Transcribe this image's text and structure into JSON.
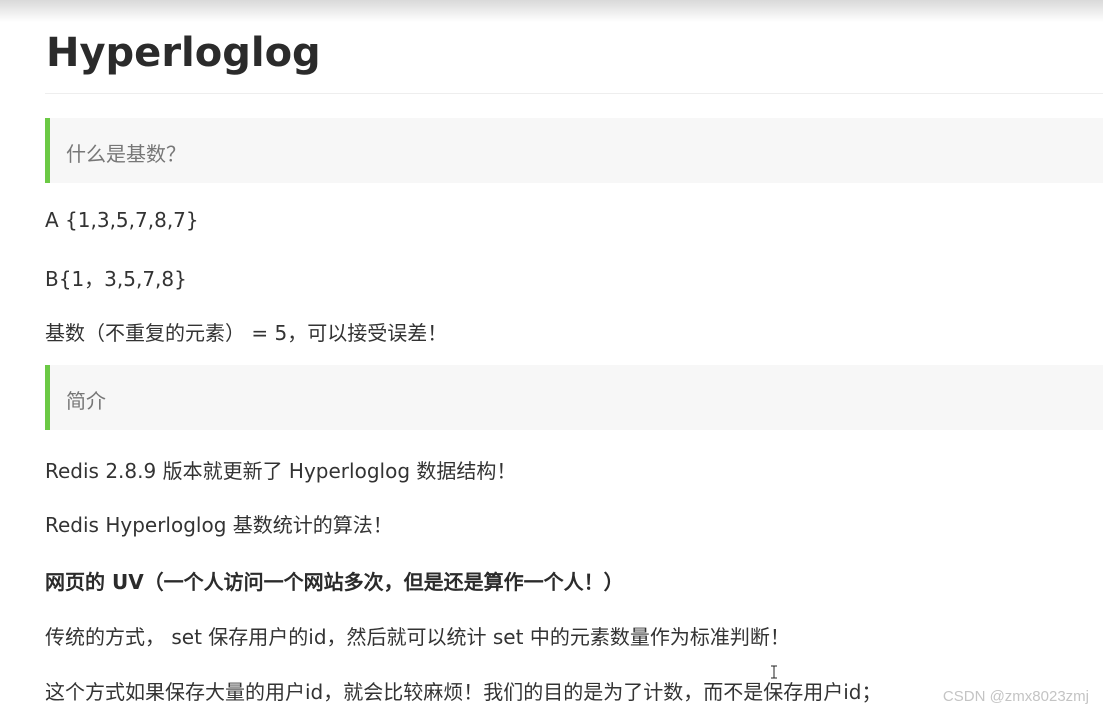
{
  "doc": {
    "title": "Hyperloglog",
    "quote1": "什么是基数？",
    "lines1": [
      "A {1,3,5,7,8,7}",
      "B{1，3,5,7,8}",
      "基数（不重复的元素） = 5，可以接受误差！"
    ],
    "quote2": "简介",
    "lines2": [
      "Redis 2.8.9 版本就更新了 Hyperloglog 数据结构！",
      "Redis Hyperloglog  基数统计的算法！",
      "网页的 UV（一个人访问一个网站多次，但是还是算作一个人！）",
      "传统的方式， set 保存用户的id，然后就可以统计 set 中的元素数量作为标准判断！",
      "这个方式如果保存大量的用户id，就会比较麻烦！我们的目的是为了计数，而不是保存用户id；"
    ]
  },
  "watermark": "CSDN @zmx8023zmj",
  "colors": {
    "accent": "#6bc945",
    "quote_bg": "#f7f7f7",
    "text": "#333333"
  }
}
